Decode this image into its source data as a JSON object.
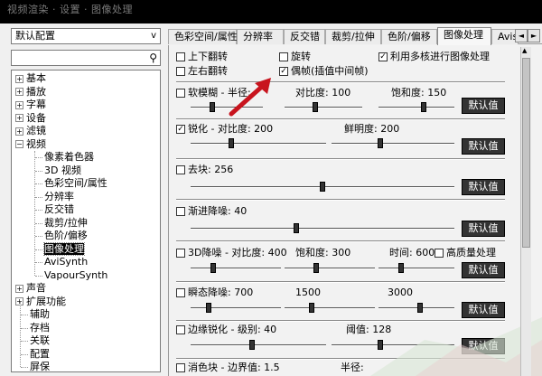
{
  "window": {
    "title": "视频渲染 · 设置 · 图像处理"
  },
  "left_panel": {
    "profile": "默认配置",
    "search_placeholder": "",
    "tree": [
      {
        "label": "基本",
        "expandable": true
      },
      {
        "label": "播放",
        "expandable": true
      },
      {
        "label": "字幕",
        "expandable": true
      },
      {
        "label": "设备",
        "expandable": true
      },
      {
        "label": "滤镜",
        "expandable": true
      },
      {
        "label": "视频",
        "expandable": true,
        "expanded": true
      },
      {
        "label": "像素着色器"
      },
      {
        "label": "3D 视频"
      },
      {
        "label": "色彩空间/属性"
      },
      {
        "label": "分辨率"
      },
      {
        "label": "反交错"
      },
      {
        "label": "裁剪/拉伸"
      },
      {
        "label": "色阶/偏移"
      },
      {
        "label": "图像处理",
        "selected": true
      },
      {
        "label": "AviSynth"
      },
      {
        "label": "VapourSynth"
      },
      {
        "label": "声音",
        "expandable": true
      },
      {
        "label": "扩展功能",
        "expandable": true
      },
      {
        "label": "辅助"
      },
      {
        "label": "存档"
      },
      {
        "label": "关联"
      },
      {
        "label": "配置"
      },
      {
        "label": "屏保"
      }
    ]
  },
  "tabs": [
    "色彩空间/属性",
    "分辨率",
    "反交错",
    "裁剪/拉伸",
    "色阶/偏移",
    "图像处理",
    "Avis"
  ],
  "active_tab": "图像处理",
  "options": {
    "flip_vertical": "上下翻转",
    "flip_horizontal": "左右翻转",
    "rotate": "旋转",
    "odd_even": "偶帧(插值中间帧)",
    "multicore": "利用多核进行图像处理"
  },
  "sections": {
    "soft_blur": {
      "label": "软模糊 - 半径:",
      "contrast_label": "对比度:",
      "contrast_value": "100",
      "saturation_label": "饱和度:",
      "saturation_value": "150",
      "radius_level": 0.3,
      "contrast_level": 0.4,
      "saturation_level": 0.6
    },
    "sharpen": {
      "label": "锐化 - 对比度:",
      "contrast_value": "200",
      "brightness_label": "鲜明度:",
      "brightness_value": "200",
      "contrast_level": 0.3,
      "brightness_level": 0.4
    },
    "deblock": {
      "label": "去块:",
      "value": "256",
      "level": 0.5
    },
    "gradual_denoise": {
      "label": "渐进降噪:",
      "value": "40",
      "level": 0.4
    },
    "denoise_3d": {
      "label": "3D降噪 - 对比度:",
      "contrast_value": "400",
      "saturation_label": "饱和度:",
      "saturation_value": "300",
      "time_label": "时间:",
      "time_value": "600",
      "hq_label": "高质量处理",
      "contrast_level": 0.25,
      "saturation_level": 0.35,
      "time_level": 0.3
    },
    "transient_denoise": {
      "label": "瞬态降噪:",
      "value1": "700",
      "value2": "1500",
      "value3": "3000",
      "level1": 0.2,
      "level2": 0.3,
      "level3": 0.55
    },
    "edge_sharpen": {
      "label": "边缘锐化 - 级别:",
      "level_value": "40",
      "threshold_label": "阈值:",
      "threshold_value": "128",
      "level": 0.45,
      "threshold_level": 0.4
    },
    "color_block": {
      "label": "消色块 - 边界值:",
      "value": "1.5",
      "extra_label": "半径:"
    }
  },
  "default_button": "默认值",
  "colors": {
    "accent_arrow": "#c8141e",
    "selected_bg": "#000000"
  }
}
